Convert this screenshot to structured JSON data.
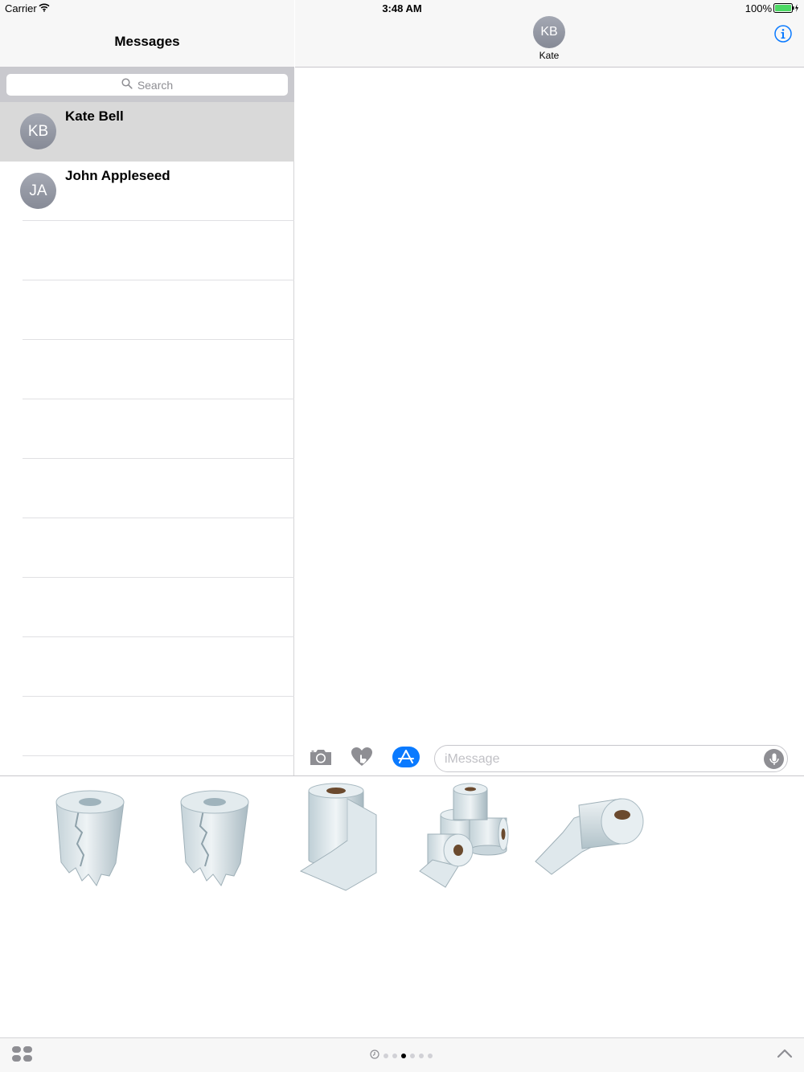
{
  "status_bar": {
    "carrier": "Carrier",
    "time": "3:48 AM",
    "battery_percent": "100%"
  },
  "messages_list": {
    "title": "Messages",
    "search_placeholder": "Search",
    "conversations": [
      {
        "initials": "KB",
        "name": "Kate Bell",
        "selected": true
      },
      {
        "initials": "JA",
        "name": "John Appleseed",
        "selected": false
      }
    ]
  },
  "conversation": {
    "contact_initials": "KB",
    "contact_name": "Kate"
  },
  "composer": {
    "placeholder": "iMessage"
  },
  "sticker_drawer": {
    "stickers": [
      "toilet-paper-roll-torn-sticker",
      "toilet-paper-roll-torn-sticker",
      "toilet-paper-roll-unrolling-sticker",
      "toilet-paper-roll-stack-sticker",
      "toilet-paper-roll-lying-sticker"
    ]
  },
  "bottom_bar": {
    "page_count": 6,
    "active_page": 3
  },
  "colors": {
    "accent": "#0a7aff",
    "avatar": "#9a9ea9",
    "nav_background": "#f7f7f7",
    "selected_row": "#d9d9d9"
  }
}
